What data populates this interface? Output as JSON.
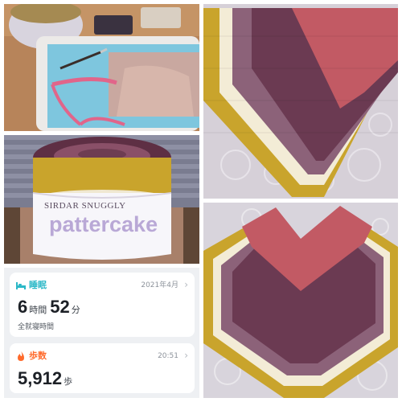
{
  "yarn_label": {
    "brand": "SIRDAR SNUGGLY",
    "product": "pattercake",
    "top_brand": "SIRDAR SNUGGLY"
  },
  "health": {
    "sleep": {
      "label": "睡眠",
      "date": "2021年4月",
      "hours": "6",
      "hours_unit": "時間",
      "minutes": "52",
      "minutes_unit": "分",
      "caption": "全就寝時間",
      "accent": "#2bb8c7"
    },
    "steps": {
      "label": "歩数",
      "time": "20:51",
      "value": "5,912",
      "unit": "歩",
      "accent": "#ff6a2b"
    },
    "chevron": "›"
  },
  "colors": {
    "yarn_mustard": "#c9a42c",
    "yarn_cream": "#f3ecd6",
    "yarn_rose": "#c25a64",
    "yarn_plum": "#6b3a52",
    "yarn_purple": "#8c6279",
    "blanket": "#d6d0d8"
  },
  "icons": [
    "bed-icon",
    "fire-icon",
    "chevron-right-icon"
  ]
}
